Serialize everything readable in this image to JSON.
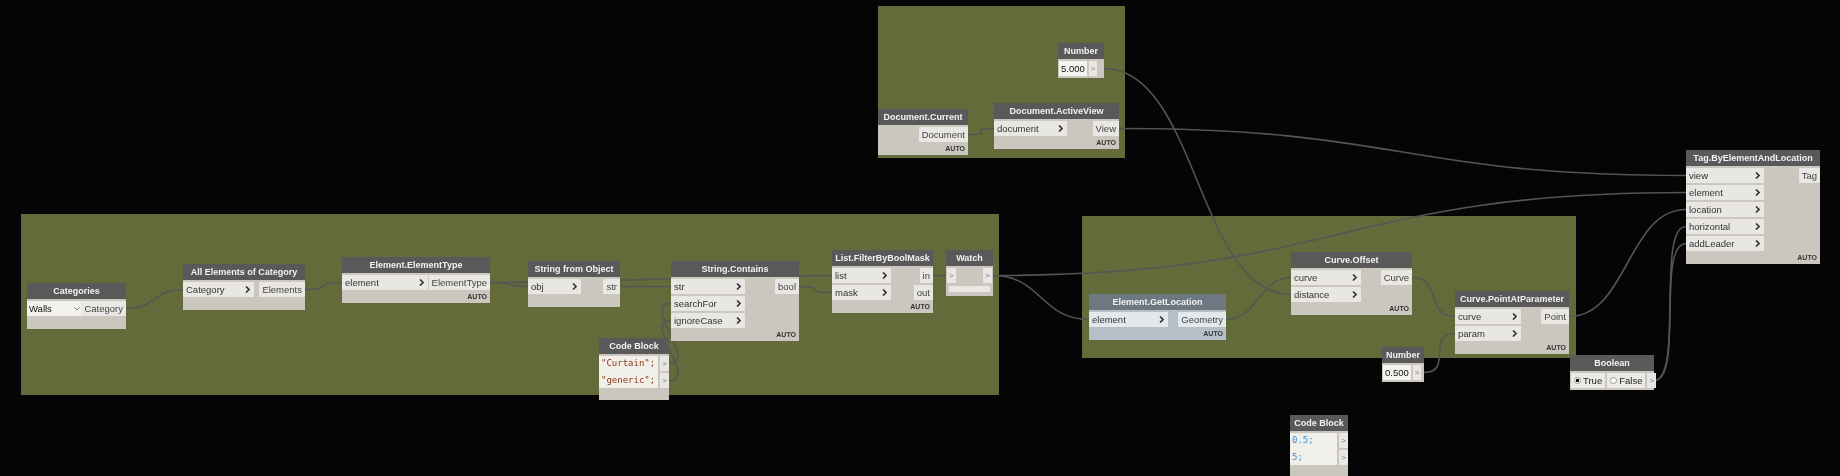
{
  "nodes": [
    {
      "title": "Number",
      "selected": false,
      "kind": "number",
      "value": "5.000",
      "outputs": [
        ">"
      ]
    },
    {
      "title": "Document.Current",
      "selected": false,
      "kind": "function",
      "outputs": [
        "Document"
      ],
      "lacing": "AUTO"
    },
    {
      "title": "Document.ActiveView",
      "selected": false,
      "kind": "function",
      "inputs": [
        "document"
      ],
      "outputs": [
        "View"
      ],
      "lacing": "AUTO"
    },
    {
      "title": "Tag.ByElementAndLocation",
      "selected": false,
      "kind": "function",
      "inputs": [
        "view",
        "element",
        "location",
        "horizontal",
        "addLeader"
      ],
      "outputs": [
        "Tag"
      ],
      "lacing": "AUTO"
    },
    {
      "title": "Categories",
      "selected": false,
      "kind": "dropdown",
      "value": "Walls",
      "outputs": [
        "Category"
      ]
    },
    {
      "title": "All Elements of Category",
      "selected": false,
      "kind": "function",
      "inputs": [
        "Category"
      ],
      "outputs": [
        "Elements"
      ]
    },
    {
      "title": "Element.ElementType",
      "selected": false,
      "kind": "function",
      "inputs": [
        "element"
      ],
      "outputs": [
        "ElementType"
      ],
      "lacing": "AUTO"
    },
    {
      "title": "String from Object",
      "selected": false,
      "kind": "function",
      "inputs": [
        "obj"
      ],
      "outputs": [
        "str"
      ]
    },
    {
      "title": "String.Contains",
      "selected": false,
      "kind": "function",
      "inputs": [
        "str",
        "searchFor",
        "ignoreCase"
      ],
      "outputs": [
        "bool"
      ],
      "lacing": "AUTO"
    },
    {
      "title": "List.FilterByBoolMask",
      "selected": false,
      "kind": "function",
      "inputs": [
        "list",
        "mask"
      ],
      "outputs": [
        "in",
        "out"
      ],
      "lacing": "AUTO"
    },
    {
      "title": "Watch",
      "selected": false,
      "kind": "watch",
      "inputs": [
        ">"
      ],
      "outputs": [
        ">"
      ]
    },
    {
      "title": "Element.GetLocation",
      "selected": true,
      "kind": "function",
      "inputs": [
        "element"
      ],
      "outputs": [
        "Geometry"
      ],
      "lacing": "AUTO"
    },
    {
      "title": "Curve.Offset",
      "selected": false,
      "kind": "function",
      "inputs": [
        "curve",
        "distance"
      ],
      "outputs": [
        "Curve"
      ],
      "lacing": "AUTO"
    },
    {
      "title": "Curve.PointAtParameter",
      "selected": false,
      "kind": "function",
      "inputs": [
        "curve",
        "param"
      ],
      "outputs": [
        "Point"
      ],
      "lacing": "AUTO"
    },
    {
      "title": "Code Block",
      "selected": false,
      "kind": "code",
      "lines": [
        {
          "text": "\"Curtain\";",
          "kind": "string"
        },
        {
          "text": "\"generic\";",
          "kind": "string"
        }
      ],
      "outputs": [
        ">",
        ">"
      ]
    },
    {
      "title": "Number",
      "selected": false,
      "kind": "number",
      "value": "0.500",
      "outputs": [
        ">"
      ]
    },
    {
      "title": "Boolean",
      "selected": false,
      "kind": "boolean",
      "options": [
        {
          "label": "True",
          "selected": true
        },
        {
          "label": "False",
          "selected": false
        }
      ],
      "outputs": [
        ">"
      ]
    },
    {
      "title": "Code Block",
      "selected": false,
      "kind": "code",
      "lines": [
        {
          "text": "0.5;",
          "kind": "number"
        },
        {
          "text": "5;",
          "kind": "number"
        }
      ],
      "outputs": [
        ">",
        ">"
      ]
    }
  ]
}
